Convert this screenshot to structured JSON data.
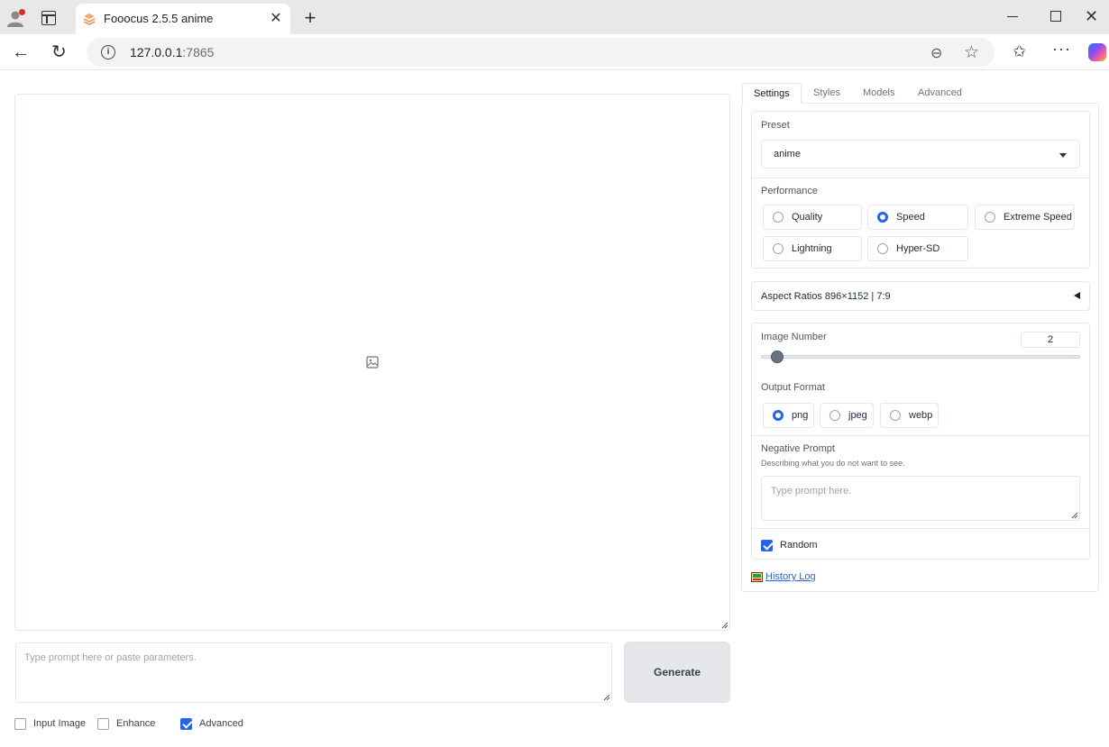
{
  "browser": {
    "tab_title": "Fooocus 2.5.5 anime",
    "url_host": "127.0.0.1",
    "url_port": ":7865",
    "new_tab_symbol": "+",
    "close_symbol": "✕"
  },
  "main": {
    "prompt_placeholder": "Type prompt here or paste parameters.",
    "generate_label": "Generate",
    "checkboxes": [
      {
        "label": "Input Image",
        "checked": false
      },
      {
        "label": "Enhance",
        "checked": false
      },
      {
        "label": "Advanced",
        "checked": true
      }
    ]
  },
  "panel": {
    "tabs": [
      "Settings",
      "Styles",
      "Models",
      "Advanced"
    ],
    "active_tab": "Settings",
    "preset": {
      "label": "Preset",
      "value": "anime"
    },
    "performance": {
      "label": "Performance",
      "options": [
        "Quality",
        "Speed",
        "Extreme Speed",
        "Lightning",
        "Hyper-SD"
      ],
      "selected": "Speed"
    },
    "aspect_ratios": {
      "label": "Aspect Ratios 896×1152 | 7:9"
    },
    "image_number": {
      "label": "Image Number",
      "value": "2",
      "min": 1,
      "max": 32,
      "current": 2
    },
    "output_format": {
      "label": "Output Format",
      "options": [
        "png",
        "jpeg",
        "webp"
      ],
      "selected": "png"
    },
    "negative_prompt": {
      "label": "Negative Prompt",
      "sublabel": "Describing what you do not want to see.",
      "placeholder": "Type prompt here."
    },
    "random": {
      "label": "Random",
      "checked": true
    },
    "history_log": "History Log"
  },
  "colors": {
    "accent": "#2563eb",
    "border": "#e5e7eb",
    "generate_bg": "#e5e7eb"
  }
}
